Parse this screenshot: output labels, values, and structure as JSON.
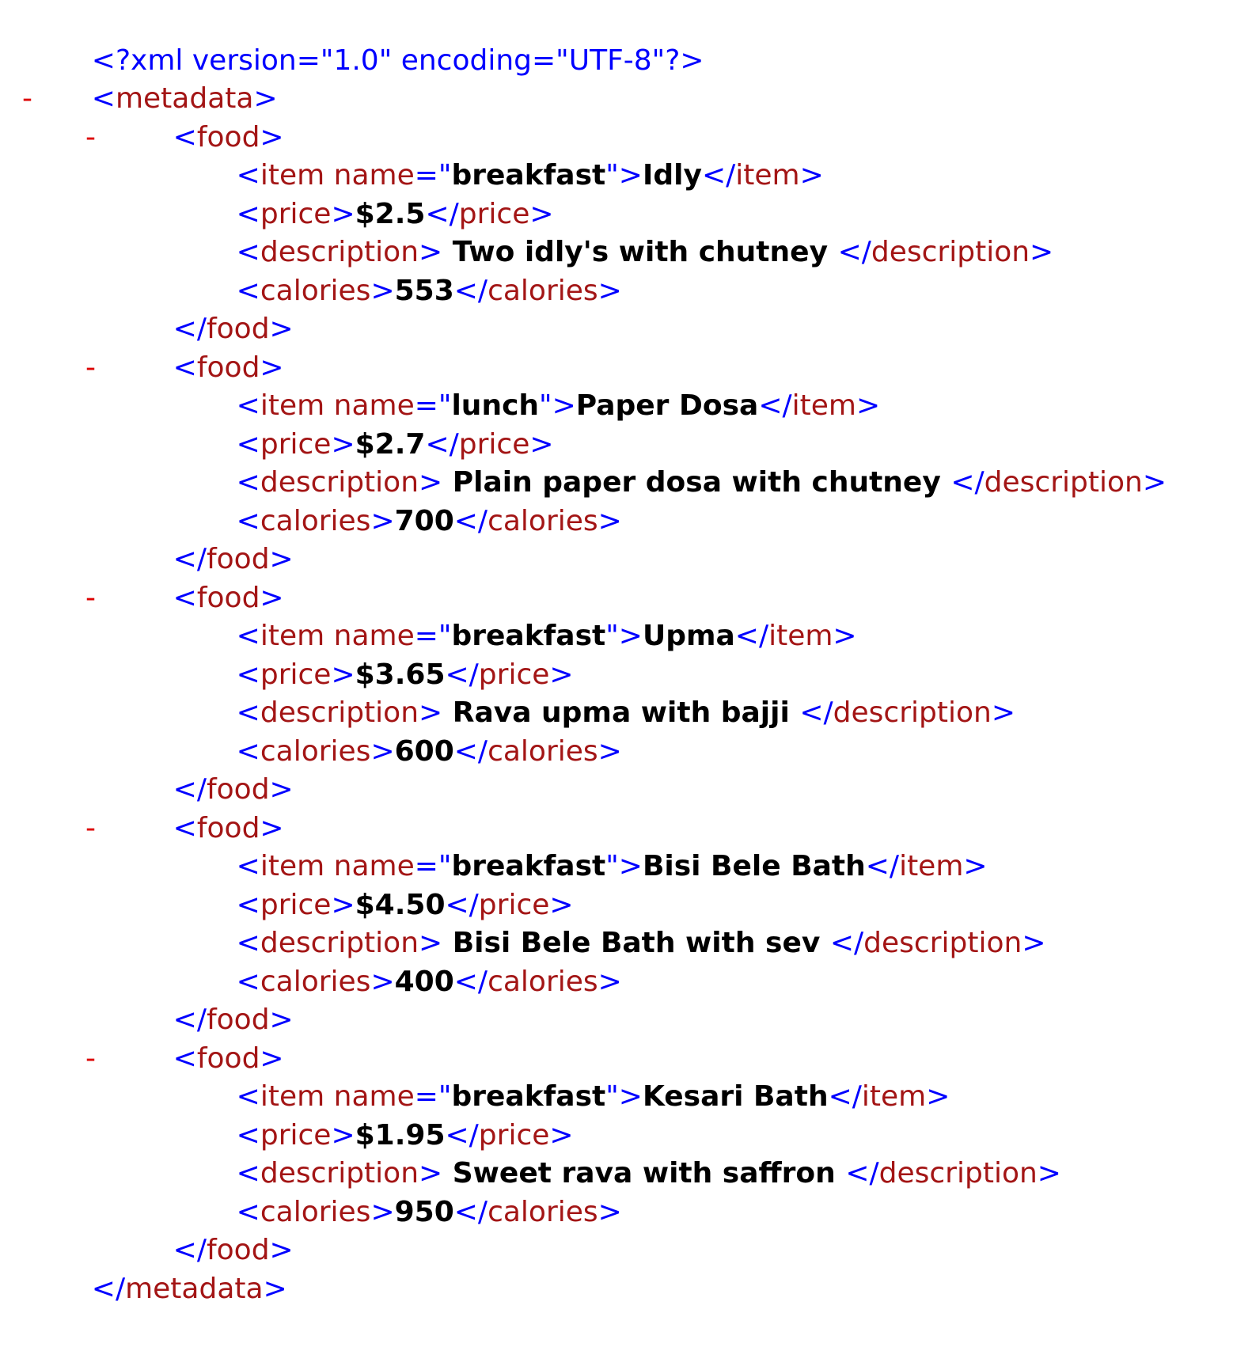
{
  "declaration": "<?xml version=\"1.0\" encoding=\"UTF-8\"?>",
  "toggle_symbol": "-",
  "root_tag": "metadata",
  "item_tag": "food",
  "field_tags": {
    "item": "item",
    "item_attr": "name",
    "price": "price",
    "description": "description",
    "calories": "calories"
  },
  "foods": [
    {
      "name": "breakfast",
      "item": "Idly",
      "price": "$2.5",
      "description": " Two idly's with chutney ",
      "calories": "553"
    },
    {
      "name": "lunch",
      "item": "Paper Dosa",
      "price": "$2.7",
      "description": " Plain paper dosa with chutney ",
      "calories": "700"
    },
    {
      "name": "breakfast",
      "item": "Upma",
      "price": "$3.65",
      "description": " Rava upma with bajji ",
      "calories": "600"
    },
    {
      "name": "breakfast",
      "item": "Bisi Bele Bath",
      "price": "$4.50",
      "description": " Bisi Bele Bath with sev ",
      "calories": "400"
    },
    {
      "name": "breakfast",
      "item": "Kesari Bath",
      "price": "$1.95",
      "description": " Sweet rava with saffron ",
      "calories": "950"
    }
  ],
  "colors": {
    "bracket": "#0000ff",
    "tag": "#a31515",
    "value": "#000000",
    "toggle": "#dd0000"
  }
}
